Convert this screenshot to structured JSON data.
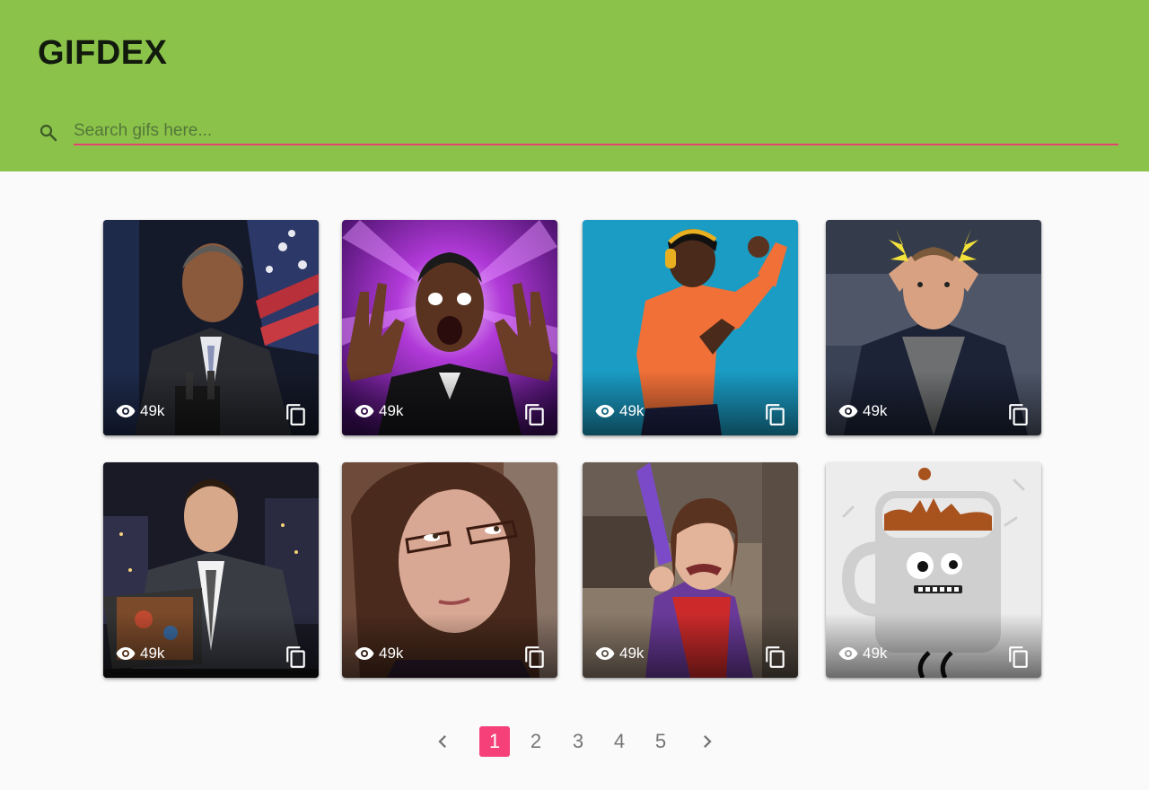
{
  "app": {
    "title": "GIFDEX"
  },
  "search": {
    "placeholder": "Search gifs here...",
    "value": "",
    "icon": "search-icon"
  },
  "colors": {
    "appbar": "#8bc34a",
    "accent": "#f5407a",
    "underline": "#e5436f",
    "background": "#fafafa"
  },
  "gifs": [
    {
      "views": "49k",
      "subject": "man-at-podium"
    },
    {
      "views": "49k",
      "subject": "surprised-man-cosmic"
    },
    {
      "views": "49k",
      "subject": "dancing-man-headphones"
    },
    {
      "views": "49k",
      "subject": "mind-blown-man"
    },
    {
      "views": "49k",
      "subject": "man-reading-book"
    },
    {
      "views": "49k",
      "subject": "woman-eye-roll"
    },
    {
      "views": "49k",
      "subject": "angry-girl"
    },
    {
      "views": "49k",
      "subject": "coffee-mug-character"
    }
  ],
  "pagination": {
    "pages": [
      "1",
      "2",
      "3",
      "4",
      "5"
    ],
    "current": "1",
    "prev_icon": "chevron-left-icon",
    "next_icon": "chevron-right-icon"
  }
}
